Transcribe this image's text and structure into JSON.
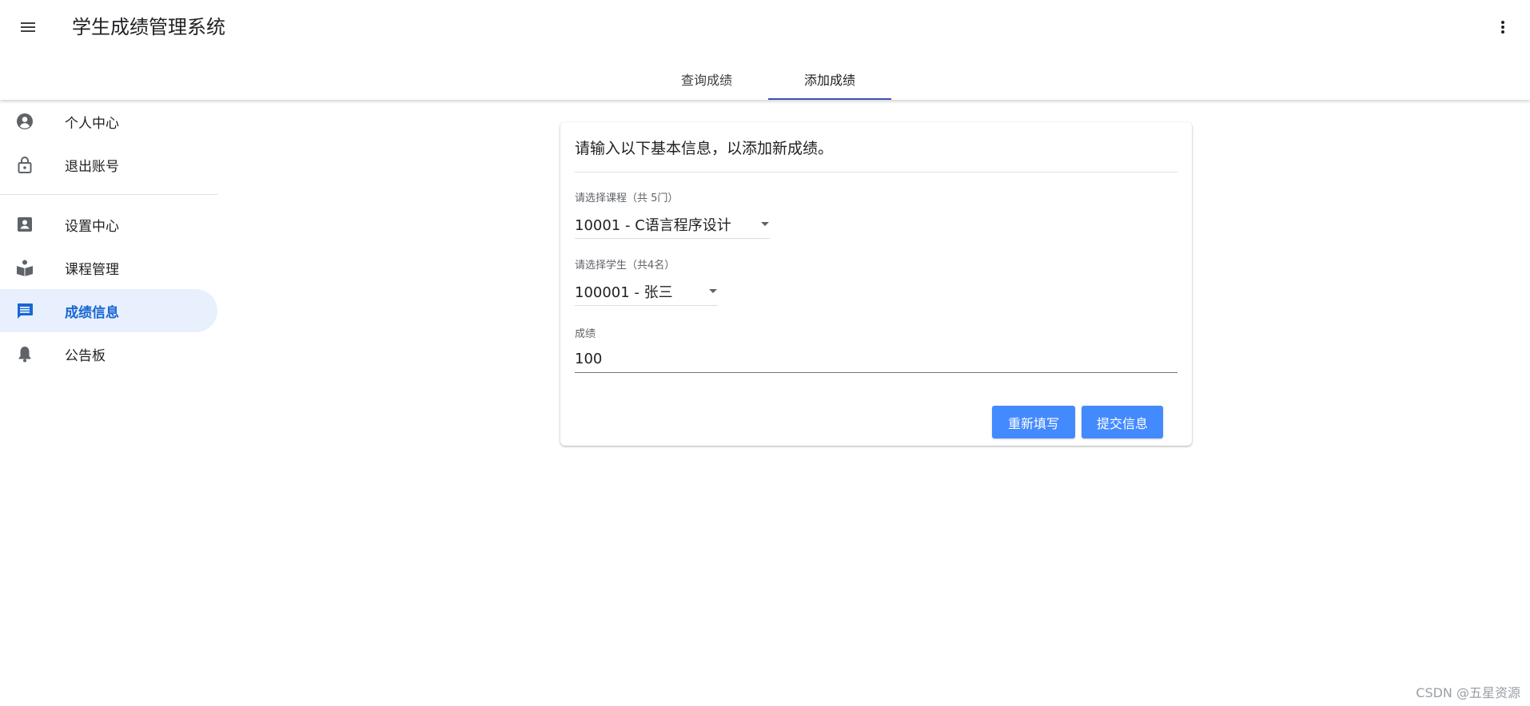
{
  "header": {
    "title": "学生成绩管理系统",
    "menu_icon": "menu-icon",
    "more_icon": "more-vert-icon"
  },
  "tabs": [
    {
      "label": "查询成绩",
      "active": false
    },
    {
      "label": "添加成绩",
      "active": true
    }
  ],
  "sidebar": {
    "items": [
      {
        "label": "个人中心",
        "icon": "account-circle-icon"
      },
      {
        "label": "退出账号",
        "icon": "lock-open-icon"
      },
      {
        "label": "设置中心",
        "icon": "contact-card-icon"
      },
      {
        "label": "课程管理",
        "icon": "book-reader-icon"
      },
      {
        "label": "成绩信息",
        "icon": "chat-message-icon",
        "active": true
      },
      {
        "label": "公告板",
        "icon": "bell-icon"
      }
    ]
  },
  "form": {
    "title": "请输入以下基本信息，以添加新成绩。",
    "course_label": "请选择课程（共 5门）",
    "course_value": "10001 - C语言程序设计",
    "student_label": "请选择学生（共4名）",
    "student_value": "100001 - 张三",
    "score_label": "成绩",
    "score_value": "100",
    "reset_label": "重新填写",
    "submit_label": "提交信息"
  },
  "watermark": "CSDN @五星资源",
  "colors": {
    "accent": "#448aff",
    "active_nav_bg": "#e8f0fe",
    "active_nav_text": "#1967d2",
    "tab_indicator": "#3f51b5"
  }
}
